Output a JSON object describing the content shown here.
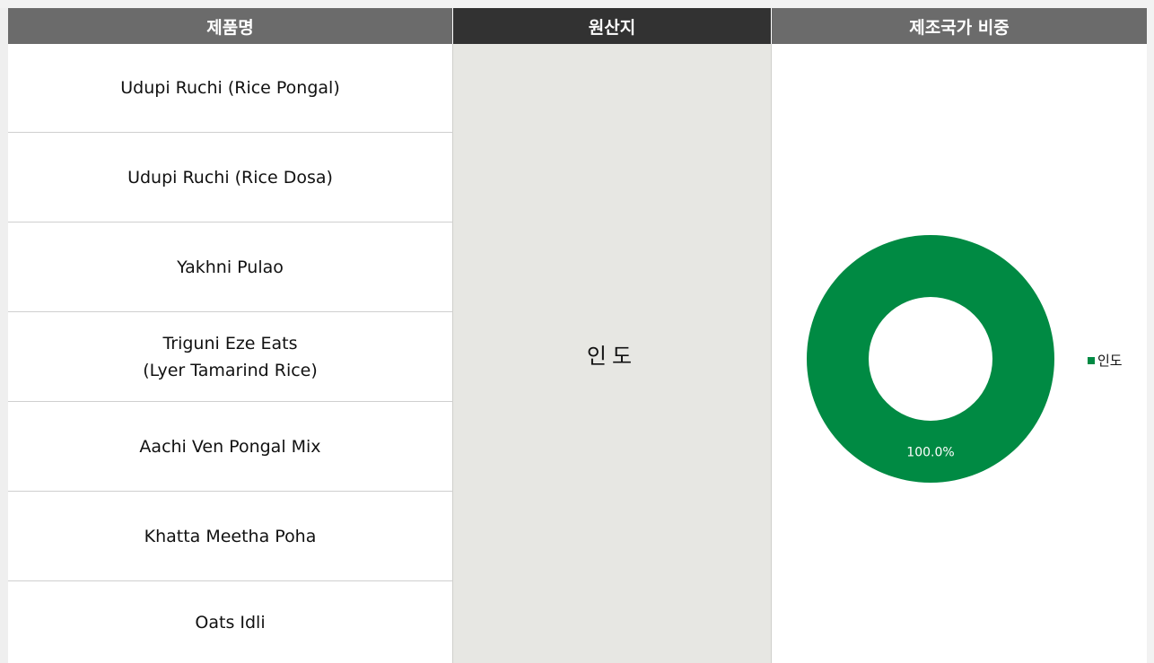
{
  "header": {
    "product_label": "제품명",
    "origin_label": "원산지",
    "share_label": "제조국가 비중"
  },
  "products": [
    "Udupi Ruchi (Rice Pongal)",
    "Udupi Ruchi (Rice Dosa)",
    "Yakhni Pulao",
    "Triguni Eze Eats\n(Lyer Tamarind Rice)",
    "Aachi Ven Pongal Mix",
    "Khatta Meetha Poha",
    "Oats Idli"
  ],
  "origin": "인도",
  "chart_data": {
    "type": "pie",
    "donut": true,
    "categories": [
      "인도"
    ],
    "values": [
      100.0
    ],
    "data_labels": [
      "100.0%"
    ],
    "colors": [
      "#008a43"
    ],
    "legend_position": "right",
    "title": "",
    "xlabel": "",
    "ylabel": ""
  }
}
